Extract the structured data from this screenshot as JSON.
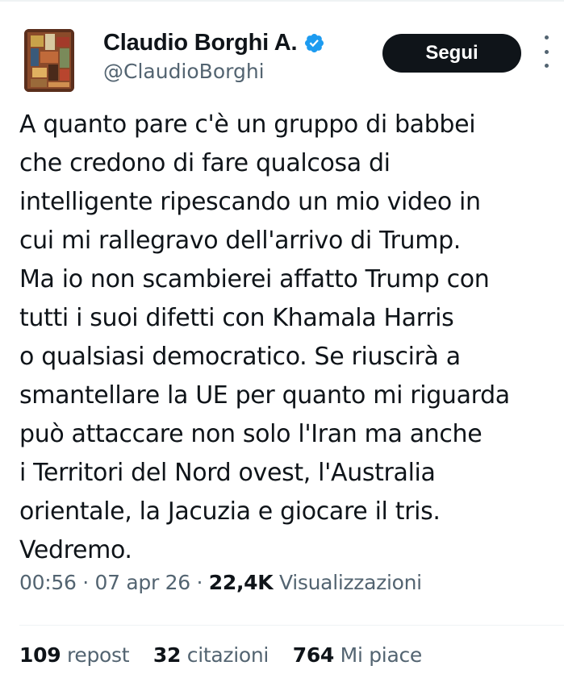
{
  "user": {
    "display_name": "Claudio Borghi A.",
    "handle": "@ClaudioBorghi",
    "verified_icon": "verified-badge-icon",
    "follow_label": "Segui"
  },
  "tweet": {
    "lines": [
      "A quanto pare c'è un gruppo di babbei",
      "che credono di fare qualcosa di",
      "intelligente ripescando un mio video in",
      "cui mi rallegravo dell'arrivo di Trump.",
      "Ma io non scambierei affatto Trump con",
      "tutti i suoi difetti con Khamala Harris",
      "o qualsiasi democratico. Se riuscirà a",
      "smantellare la UE per quanto mi riguarda",
      "può attaccare non solo l'Iran ma anche",
      "i Territori del Nord ovest, l'Australia",
      "orientale, la Jacuzia e giocare il tris.",
      "Vedremo."
    ]
  },
  "meta": {
    "time": "00:56",
    "date": "07 apr 26",
    "views_count": "22,4K",
    "views_label": "Visualizzazioni",
    "separator": "·"
  },
  "stats": {
    "reposts_count": "109",
    "reposts_label": "repost",
    "quotes_count": "32",
    "quotes_label": "citazioni",
    "likes_count": "764",
    "likes_label": "Mi piace"
  },
  "colors": {
    "text_primary": "#0f1419",
    "text_secondary": "#536471",
    "verified_blue": "#1d9bf0",
    "button_bg": "#0f1419"
  }
}
